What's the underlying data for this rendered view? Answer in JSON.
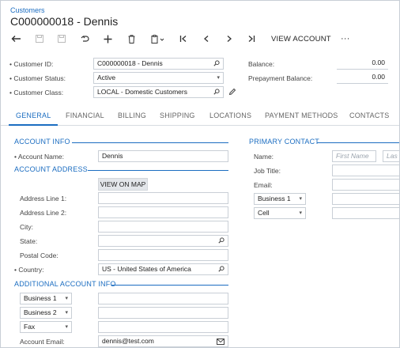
{
  "breadcrumb": "Customers",
  "page_title": "C000000018 - Dennis",
  "toolbar": {
    "view_account": "VIEW ACCOUNT",
    "icons": [
      "back-arrow",
      "save",
      "save-close",
      "undo",
      "add",
      "delete",
      "copy-paste",
      "first",
      "previous",
      "next",
      "last",
      "more"
    ],
    "more": "···"
  },
  "header": {
    "customer_id": {
      "label": "Customer ID:",
      "value": "C000000018 - Dennis"
    },
    "customer_status": {
      "label": "Customer Status:",
      "value": "Active"
    },
    "customer_class": {
      "label": "Customer Class:",
      "value": "LOCAL - Domestic Customers"
    },
    "balance": {
      "label": "Balance:",
      "value": "0.00"
    },
    "prepayment_balance": {
      "label": "Prepayment Balance:",
      "value": "0.00"
    }
  },
  "tabs": [
    "GENERAL",
    "FINANCIAL",
    "BILLING",
    "SHIPPING",
    "LOCATIONS",
    "PAYMENT METHODS",
    "CONTACTS"
  ],
  "active_tab": "GENERAL",
  "account_info": {
    "title": "ACCOUNT INFO",
    "account_name_label": "Account Name:",
    "account_name": "Dennis"
  },
  "account_address": {
    "title": "ACCOUNT ADDRESS",
    "view_on_map": "VIEW ON MAP",
    "address_line1_label": "Address Line 1:",
    "address_line2_label": "Address Line 2:",
    "city_label": "City:",
    "state_label": "State:",
    "postal_code_label": "Postal Code:",
    "country_label": "Country:",
    "country": "US - United States of America"
  },
  "additional_info": {
    "title": "ADDITIONAL ACCOUNT INFO",
    "phone1_type": "Business 1",
    "phone2_type": "Business 2",
    "fax_type": "Fax",
    "account_email_label": "Account Email:",
    "account_email": "dennis@test.com"
  },
  "primary_contact": {
    "title": "PRIMARY CONTACT",
    "name_label": "Name:",
    "first_name_placeholder": "First Name",
    "last_name_placeholder": "Las",
    "job_title_label": "Job Title:",
    "email_label": "Email:",
    "phone1_type": "Business 1",
    "phone2_type": "Cell"
  },
  "colors": {
    "accent": "#1b6dc1",
    "border": "#c9cfd6",
    "button_bg": "#e3e6ea"
  }
}
